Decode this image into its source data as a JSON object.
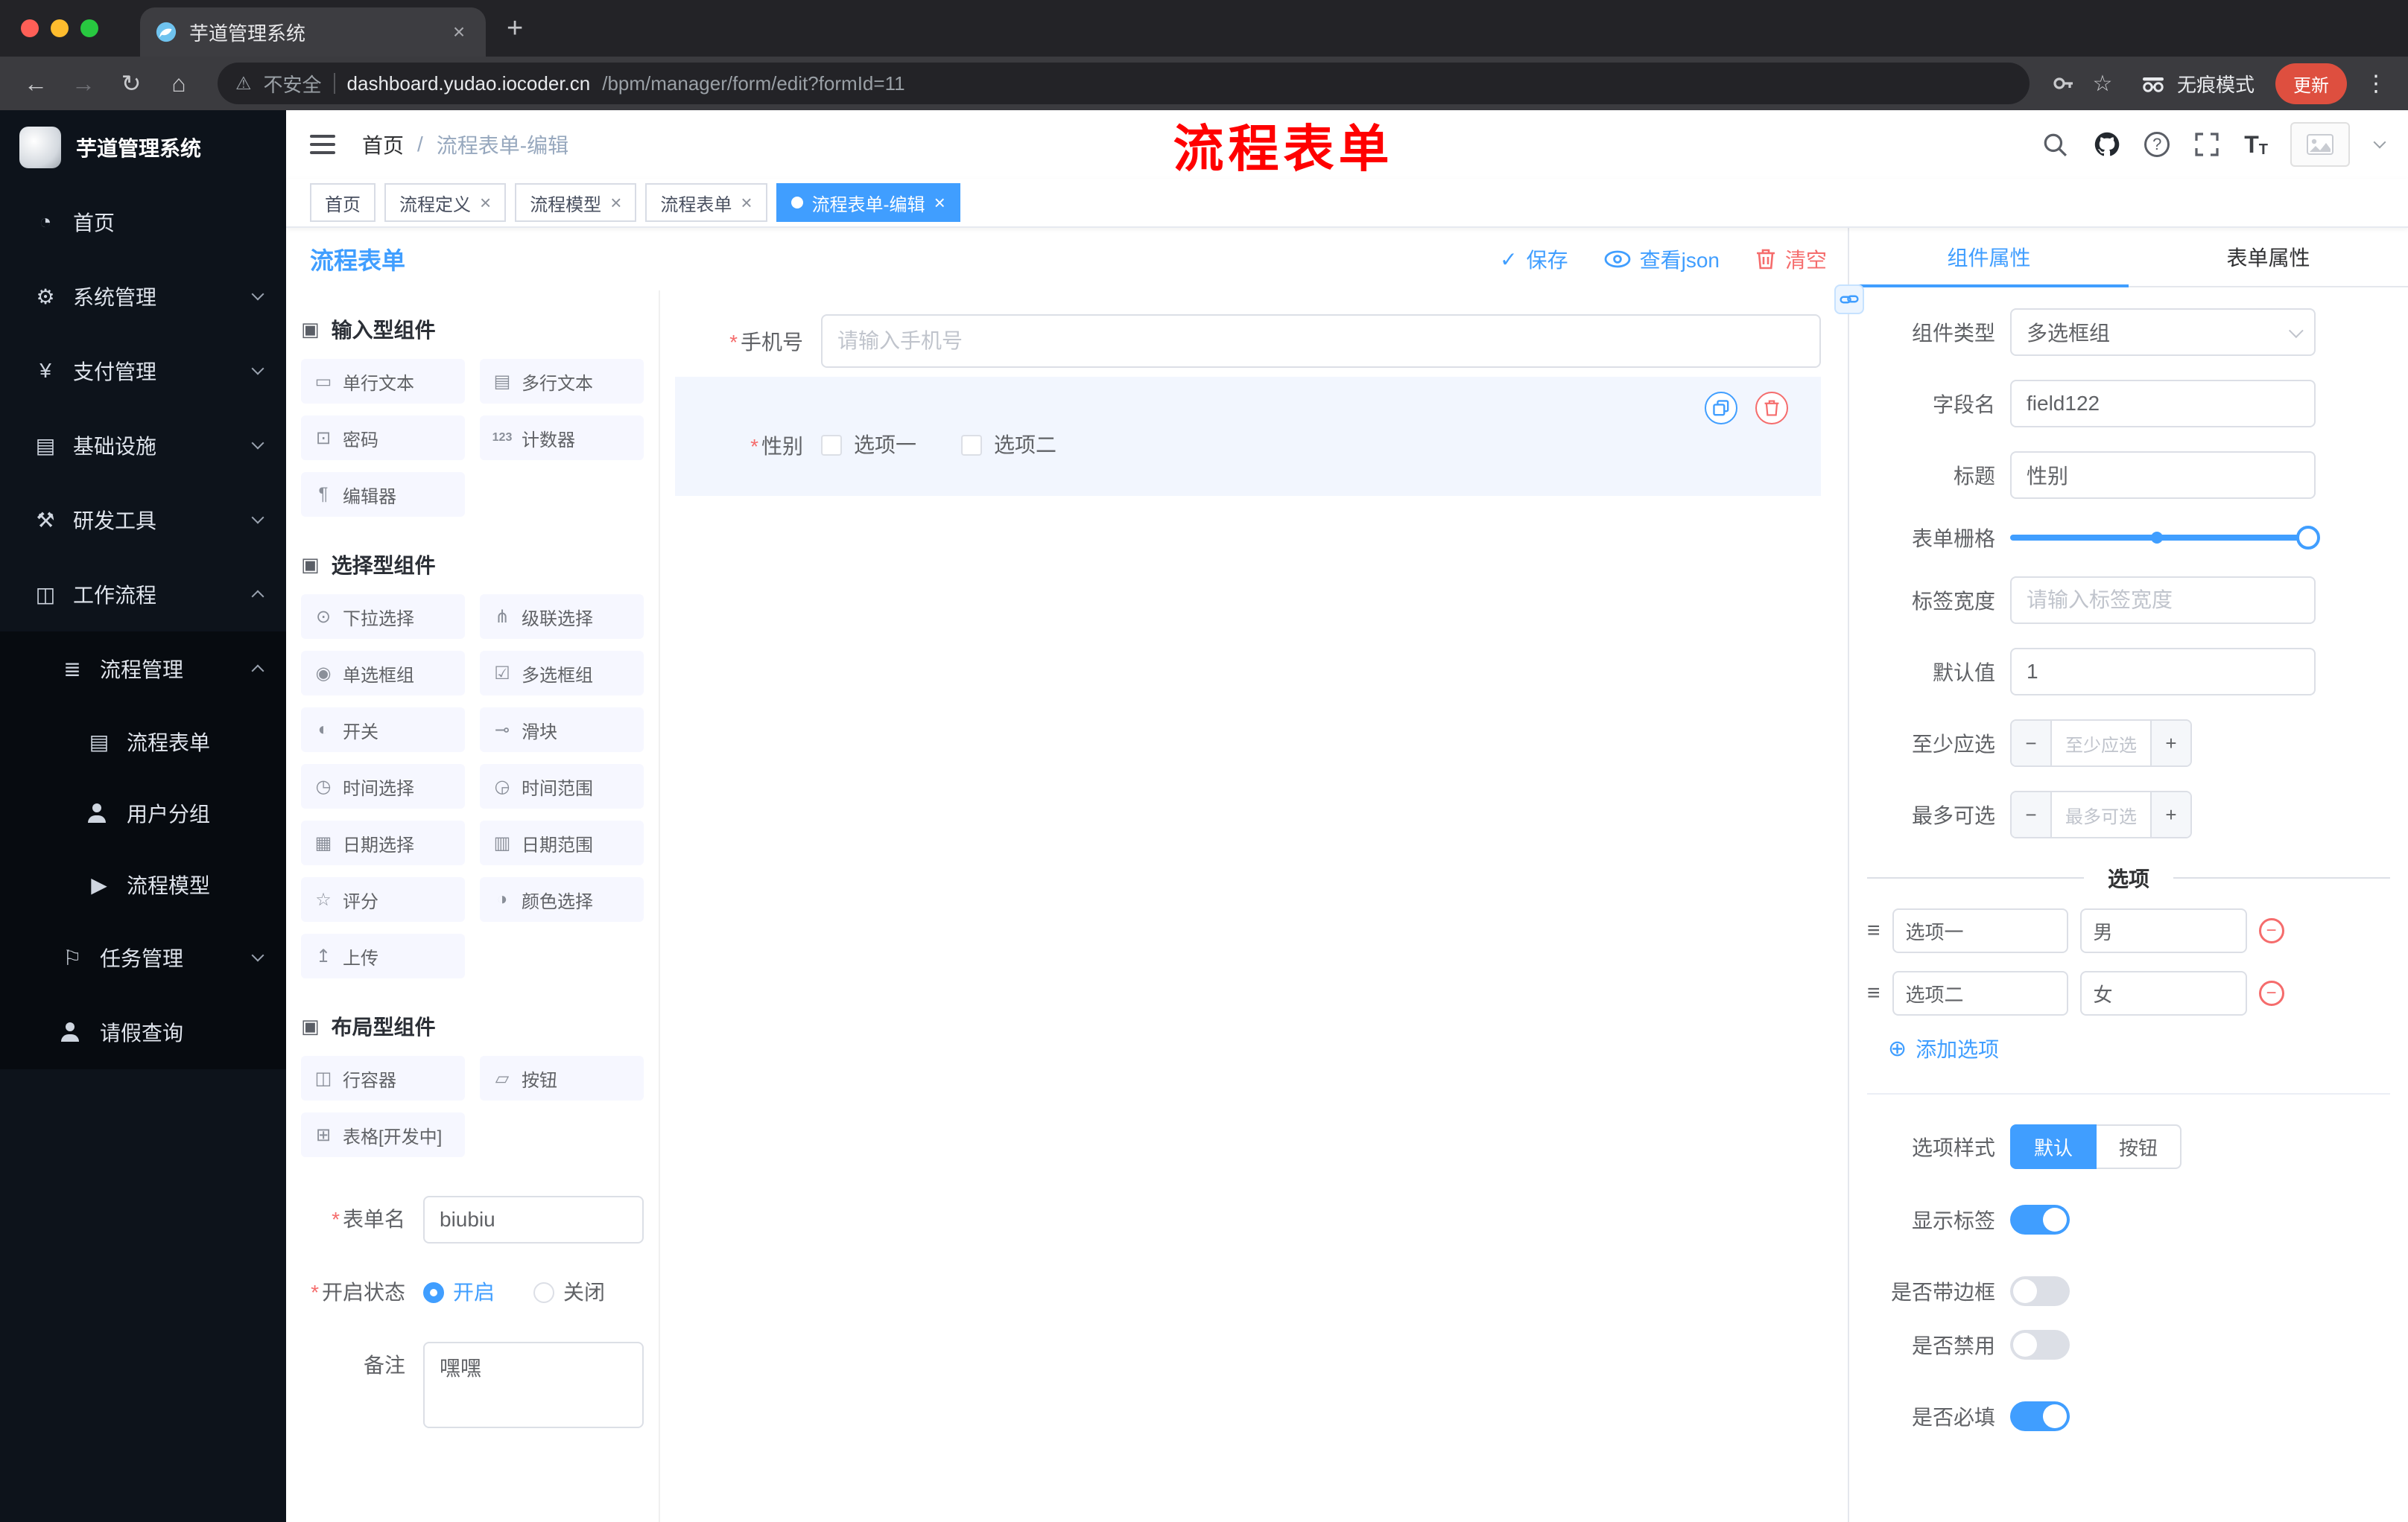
{
  "glyphs": {
    "close": "×",
    "plus": "+",
    "minus": "−",
    "check": "✓",
    "slash": "/",
    "back": "←",
    "forward": "→",
    "reload": "↻",
    "home": "⌂",
    "warning": "⚠",
    "star": "☆",
    "menu_dots": "⋮",
    "question": "?",
    "font_big": "T",
    "font_small": "T",
    "section_icon": "▣",
    "drag": "≡",
    "add_circle": "⊕",
    "remove_minus": "−",
    "i_single": "▭",
    "i_multi": "▤",
    "i_password": "⊡",
    "i_counter": "123",
    "i_editor": "¶",
    "i_select": "⊙",
    "i_cascader": "⋔",
    "i_radio": "◉",
    "i_checkbox": "☑",
    "i_switch": "◐",
    "i_slider": "⊸",
    "i_time": "◷",
    "i_timerange": "◶",
    "i_date": "▦",
    "i_daterange": "▥",
    "i_rate": "☆",
    "i_color": "◑",
    "i_upload": "↥",
    "i_row": "◫",
    "i_button": "▱",
    "i_table": "⊞",
    "s_home": "◔",
    "s_system": "⚙",
    "s_payment": "¥",
    "s_infra": "▤",
    "s_devtools": "⚒",
    "s_workflow": "◫",
    "s_pm": "≣",
    "s_form": "▤",
    "s_model": "▶",
    "s_task": "⚐"
  },
  "colors": {
    "accent": "#409eff",
    "danger": "#f56c6c",
    "annotation": "#ff0000"
  },
  "browser": {
    "tab_title": "芋道管理系统",
    "security": "不安全",
    "url_domain": "dashboard.yudao.iocoder.cn",
    "url_path": "/bpm/manager/form/edit?formId=11",
    "incognito": "无痕模式",
    "update": "更新"
  },
  "sidebar": {
    "logo_title": "芋道管理系统",
    "home": "首页",
    "system": "系统管理",
    "payment": "支付管理",
    "infra": "基础设施",
    "devtools": "研发工具",
    "workflow": "工作流程",
    "process_mgmt": "流程管理",
    "process_form": "流程表单",
    "user_group": "用户分组",
    "process_model": "流程模型",
    "task_mgmt": "任务管理",
    "leave_query": "请假查询"
  },
  "header": {
    "breadcrumb_home": "首页",
    "breadcrumb_current": "流程表单-编辑",
    "annotation": "流程表单"
  },
  "tags": {
    "t0": "首页",
    "t1": "流程定义",
    "t2": "流程模型",
    "t3": "流程表单",
    "t4": "流程表单-编辑"
  },
  "designer": {
    "title": "流程表单",
    "save": "保存",
    "view_json": "查看json",
    "clear": "清空",
    "group_input": "输入型组件",
    "group_select": "选择型组件",
    "group_layout": "布局型组件",
    "items": {
      "single": "单行文本",
      "multi": "多行文本",
      "password": "密码",
      "counter": "计数器",
      "editor": "编辑器",
      "select": "下拉选择",
      "cascader": "级联选择",
      "radio": "单选框组",
      "checkbox": "多选框组",
      "switch": "开关",
      "slider": "滑块",
      "time": "时间选择",
      "timerange": "时间范围",
      "date": "日期选择",
      "daterange": "日期范围",
      "rate": "评分",
      "color": "颜色选择",
      "upload": "上传",
      "row": "行容器",
      "button": "按钮",
      "table": "表格[开发中]"
    },
    "meta": {
      "form_name": "表单名",
      "form_name_value": "biubiu",
      "status": "开启状态",
      "on": "开启",
      "off": "关闭",
      "remark": "备注",
      "remark_value": "嘿嘿"
    }
  },
  "canvas": {
    "phone_label": "手机号",
    "phone_placeholder": "请输入手机号",
    "gender_label": "性别",
    "opt1": "选项一",
    "opt2": "选项二"
  },
  "props": {
    "tab_component": "组件属性",
    "tab_form": "表单属性",
    "type_label": "组件类型",
    "type_value": "多选框组",
    "field_label": "字段名",
    "field_value": "field122",
    "title_label": "标题",
    "title_value": "性别",
    "grid_label": "表单栅格",
    "width_label": "标签宽度",
    "width_placeholder": "请输入标签宽度",
    "default_label": "默认值",
    "default_value": "1",
    "min_label": "至少应选",
    "min_placeholder": "至少应选",
    "max_label": "最多可选",
    "max_placeholder": "最多可选",
    "divider_options": "选项",
    "o1_label": "选项一",
    "o1_value": "男",
    "o2_label": "选项二",
    "o2_value": "女",
    "add_option": "添加选项",
    "style_label": "选项样式",
    "style_default": "默认",
    "style_button": "按钮",
    "show_label_label": "显示标签",
    "border_label": "是否带边框",
    "disabled_label": "是否禁用",
    "required_label": "是否必填"
  }
}
